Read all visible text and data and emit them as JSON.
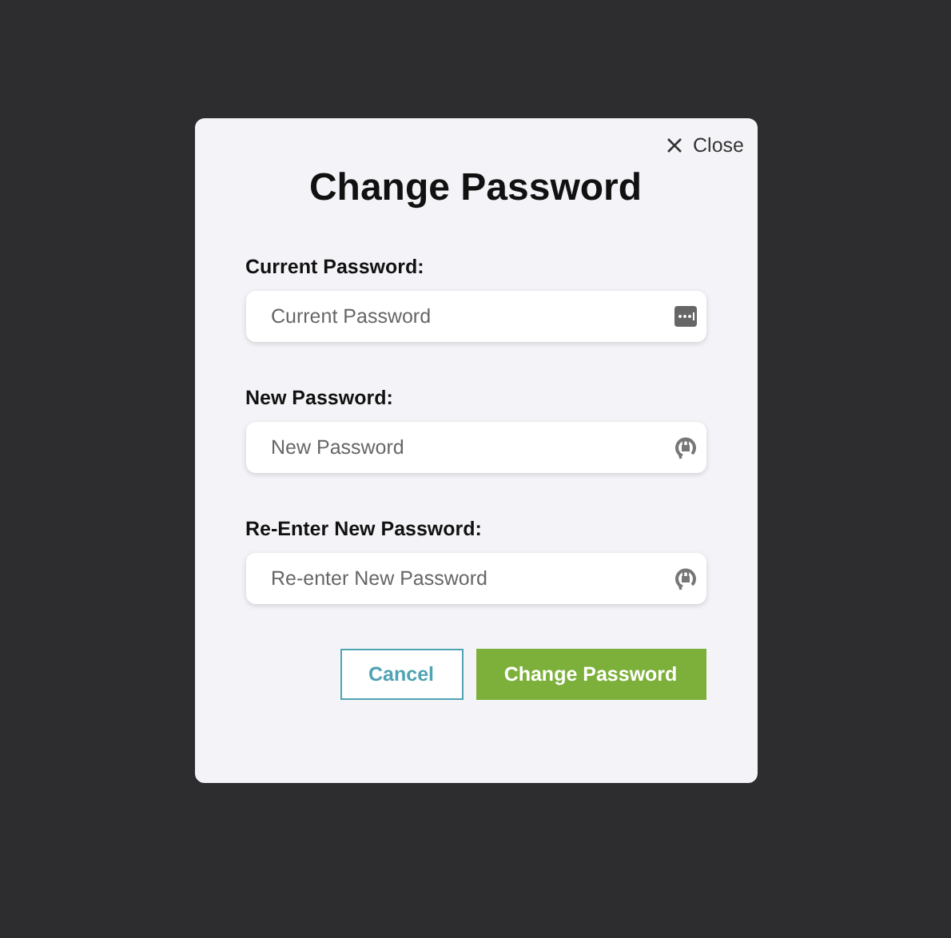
{
  "dialog": {
    "close": "Close",
    "title": "Change Password",
    "fields": [
      {
        "label": "Current Password:",
        "placeholder": "Current Password"
      },
      {
        "label": "New Password:",
        "placeholder": "New Password"
      },
      {
        "label": "Re-Enter New Password:",
        "placeholder": "Re-enter New Password"
      }
    ],
    "buttons": {
      "cancel": "Cancel",
      "submit": "Change Password"
    }
  }
}
